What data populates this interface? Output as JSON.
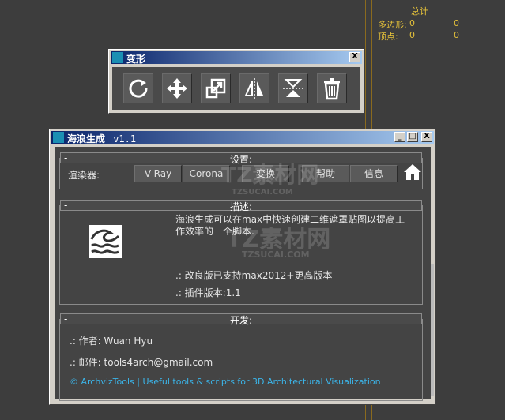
{
  "stats": {
    "header": "总计",
    "polygons_label": "多边形:",
    "polygons_a": "0",
    "polygons_b": "0",
    "vertices_label": "顶点:",
    "vertices_a": "0",
    "vertices_b": "0"
  },
  "deform_window": {
    "title": "变形",
    "close": "X",
    "tools": [
      "refresh-icon",
      "move-icon",
      "scale-icon",
      "mirror-icon",
      "flip-vertical-icon",
      "trash-icon"
    ]
  },
  "wave_window": {
    "title": "海浪生成",
    "version": "v1.1",
    "settings": {
      "label": "设置:",
      "renderer_label": "渲染器:",
      "buttons": [
        "V-Ray",
        "Corona",
        "变换",
        "帮助",
        "信息"
      ]
    },
    "description": {
      "label": "描述:",
      "text1": "海浪生成可以在max中快速创建二维遮罩贴图以提高工",
      "text2": "作效率的一个脚本.",
      "line3": ".: 改良版已支持max2012+更高版本",
      "line4": ".: 插件版本:1.1"
    },
    "developer": {
      "label": "开发:",
      "author": ".: 作者: Wuan Hyu",
      "email": ".: 邮件: tools4arch@gmail.com",
      "link": "© ArchvizTools | Useful tools & scripts for 3D Architectural Visualization"
    },
    "minus": "-"
  },
  "watermark": {
    "top": "TZ素材网",
    "top_sub": "TZSUCAI.COM",
    "mid": "TZ素材网",
    "mid_sub": "TZSUCAI.COM"
  }
}
